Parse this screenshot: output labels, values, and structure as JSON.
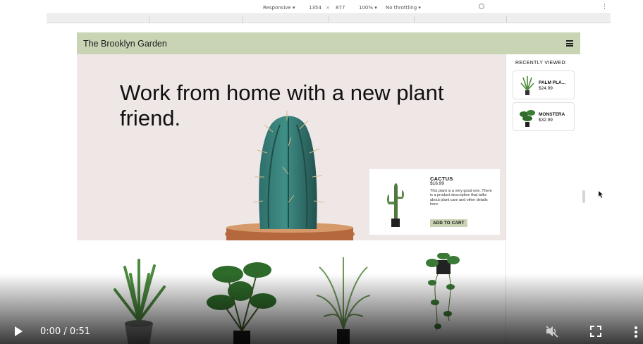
{
  "devtools": {
    "device_mode": "Responsive",
    "width": "1354",
    "separator": "×",
    "height": "877",
    "zoom": "100%",
    "throttling": "No throttling"
  },
  "site": {
    "brand": "The Brooklyn Garden",
    "hero_title": "Work from home with a new plant friend.",
    "product": {
      "name": "CACTUS",
      "price": "$16.99",
      "description": "This plant is a very good one. There is a product description that talks about plant care and other details here.",
      "button_label": "ADD TO CART"
    },
    "recently_viewed": {
      "heading": "RECENTLY VIEWED:",
      "items": [
        {
          "name": "PALM PLA...",
          "price": "$24.99"
        },
        {
          "name": "MONSTERA",
          "price": "$32.99"
        }
      ]
    }
  },
  "video": {
    "time": "0:00 / 0:51",
    "muted": true
  },
  "colors": {
    "navbar": "#c9d4b4",
    "hero_bg": "#efe6e6",
    "button": "#c9d4b4"
  }
}
